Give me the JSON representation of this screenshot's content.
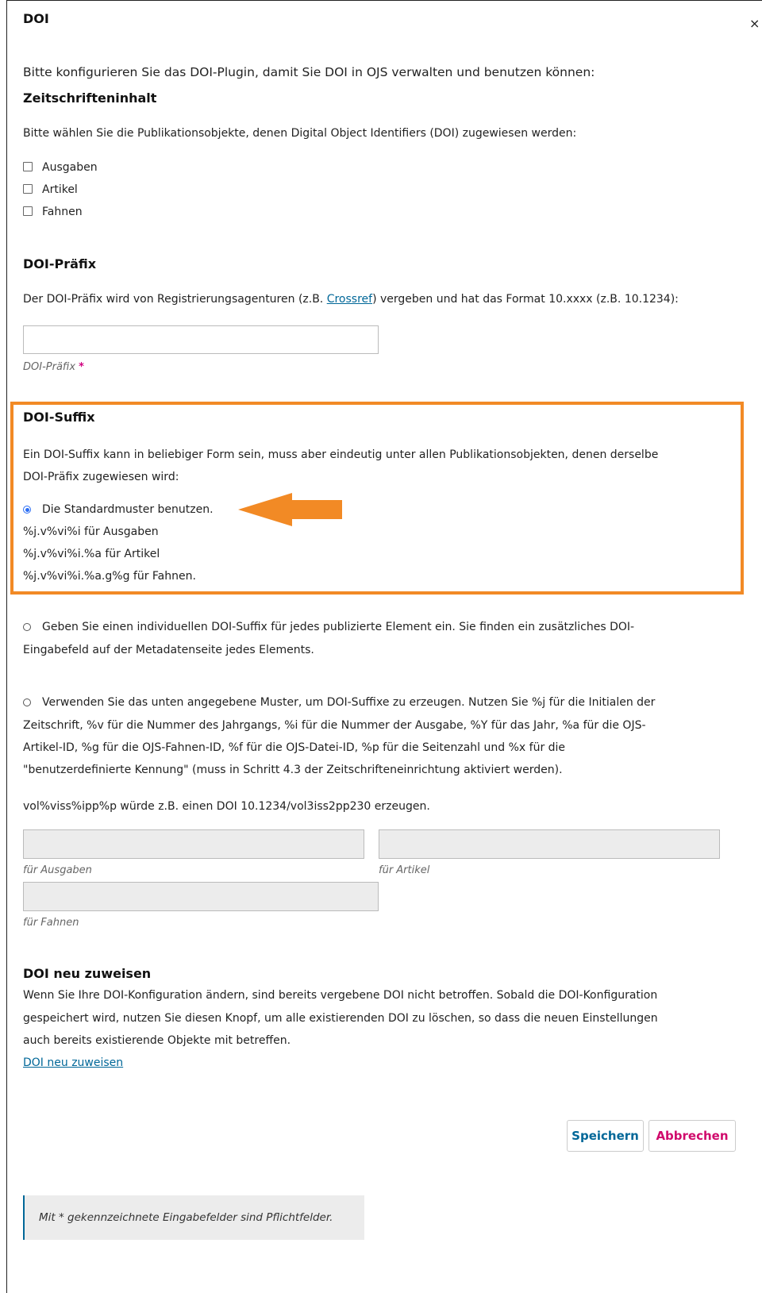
{
  "dialog": {
    "title": "DOI",
    "close_icon": "×",
    "intro": "Bitte konfigurieren Sie das DOI-Plugin, damit Sie DOI in OJS verwalten und benutzen können:"
  },
  "content": {
    "heading": "Zeitschrifteninhalt",
    "description": "Bitte wählen Sie die Publikationsobjekte, denen Digital Object Identifiers (DOI) zugewiesen werden:",
    "checkboxes": [
      {
        "label": "Ausgaben",
        "checked": false
      },
      {
        "label": "Artikel",
        "checked": false
      },
      {
        "label": "Fahnen",
        "checked": false
      }
    ]
  },
  "prefix": {
    "heading": "DOI-Präfix",
    "desc_before": "Der DOI-Präfix wird von Registrierungsagenturen (z.B. ",
    "desc_link": "Crossref",
    "desc_after": ") vergeben und hat das Format 10.xxxx (z.B. 10.1234):",
    "input_value": "",
    "input_label": "DOI-Präfix",
    "required_mark": "*"
  },
  "suffix": {
    "heading": "DOI-Suffix",
    "desc_line1": "Ein DOI-Suffix kann in beliebiger Form sein, muss aber eindeutig unter allen Publikationsobjekten, denen derselbe",
    "desc_line2": "DOI-Präfix zugewiesen wird:",
    "option_default": "Die Standardmuster benutzen.",
    "pattern_issues": "%j.v%vi%i für Ausgaben",
    "pattern_articles": "%j.v%vi%i.%a für Artikel",
    "pattern_galleys": "%j.v%vi%i.%a.g%g für Fahnen.",
    "option_custom_line1": "Geben Sie einen individuellen DOI-Suffix für jedes publizierte Element ein. Sie finden ein zusätzliches DOI-",
    "option_custom_line2": "Eingabefeld auf der Metadatenseite jedes Elements.",
    "option_pattern_line1": "Verwenden Sie das unten angegebene Muster, um DOI-Suffixe zu erzeugen. Nutzen Sie %j für die Initialen der",
    "option_pattern_line2": "Zeitschrift, %v für die Nummer des Jahrgangs, %i für die Nummer der Ausgabe, %Y für das Jahr, %a für die OJS-",
    "option_pattern_line3": "Artikel-ID, %g für die OJS-Fahnen-ID, %f für die OJS-Datei-ID, %p für die Seitenzahl und %x für die",
    "option_pattern_line4": "\"benutzerdefinierte Kennung\" (muss in Schritt 4.3 der Zeitschrifteneinrichtung aktiviert werden).",
    "example": "vol%viss%ipp%p würde z.B. einen DOI 10.1234/vol3iss2pp230 erzeugen.",
    "field_issues_label": "für Ausgaben",
    "field_articles_label": "für Artikel",
    "field_galleys_label": "für Fahnen",
    "selected_option": "default"
  },
  "reassign": {
    "heading": "DOI neu zuweisen",
    "desc_line1": "Wenn Sie Ihre DOI-Konfiguration ändern, sind bereits vergebene DOI nicht betroffen. Sobald die DOI-Konfiguration",
    "desc_line2": "gespeichert wird, nutzen Sie diesen Knopf, um alle existierenden DOI zu löschen, so dass die neuen Einstellungen",
    "desc_line3": "auch bereits existierende Objekte mit betreffen.",
    "link": "DOI neu zuweisen"
  },
  "actions": {
    "save": "Speichern",
    "cancel": "Abbrechen"
  },
  "footer_note": "Mit * gekennzeichnete Eingabefelder sind Pflichtfelder.",
  "colors": {
    "highlight": "#f28a25",
    "link": "#006798",
    "required": "#d00080",
    "cancel": "#d00a6c"
  }
}
